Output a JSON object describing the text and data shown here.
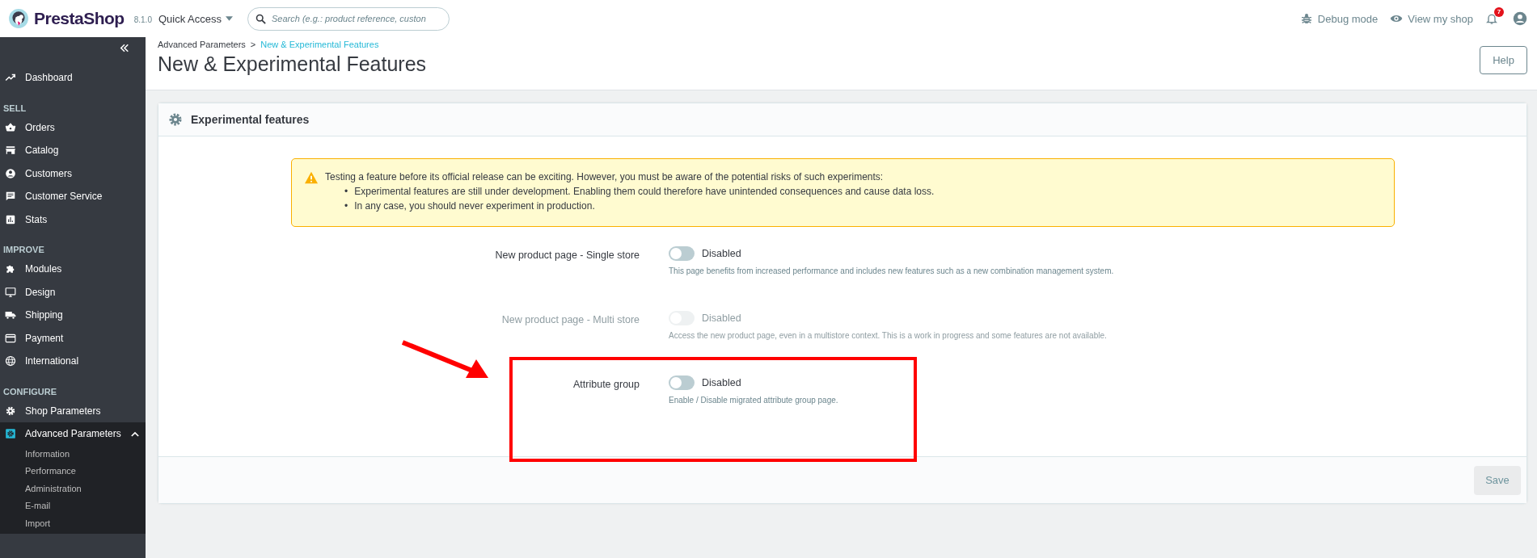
{
  "header": {
    "brand": "PrestaShop",
    "version": "8.1.0",
    "quick_access": "Quick Access",
    "search": {
      "placeholder": "Search (e.g.: product reference, custon"
    },
    "debug_mode": "Debug mode",
    "view_shop": "View my shop",
    "notifications_badge": "7"
  },
  "sidebar": {
    "top": [
      {
        "label": "Dashboard",
        "selected": false
      }
    ],
    "sections": [
      {
        "title": "SELL",
        "items": [
          {
            "label": "Orders",
            "selected": false
          },
          {
            "label": "Catalog",
            "selected": false
          },
          {
            "label": "Customers",
            "selected": false
          },
          {
            "label": "Customer Service",
            "selected": false
          },
          {
            "label": "Stats",
            "selected": false
          }
        ]
      },
      {
        "title": "IMPROVE",
        "items": [
          {
            "label": "Modules",
            "selected": false
          },
          {
            "label": "Design",
            "selected": false
          },
          {
            "label": "Shipping",
            "selected": false
          },
          {
            "label": "Payment",
            "selected": false
          },
          {
            "label": "International",
            "selected": false
          }
        ]
      },
      {
        "title": "CONFIGURE",
        "items": [
          {
            "label": "Shop Parameters",
            "selected": false
          },
          {
            "label": "Advanced Parameters",
            "selected": true,
            "expanded": true,
            "children": [
              {
                "label": "Information"
              },
              {
                "label": "Performance"
              },
              {
                "label": "Administration"
              },
              {
                "label": "E-mail"
              },
              {
                "label": "Import"
              }
            ]
          }
        ]
      }
    ]
  },
  "breadcrumb": {
    "items": [
      {
        "label": "Advanced Parameters",
        "current": false
      },
      {
        "label": "New & Experimental Features",
        "current": true
      }
    ],
    "separator": ">"
  },
  "page_title": "New & Experimental Features",
  "help_button": "Help",
  "card": {
    "title": "Experimental features",
    "alert": {
      "bullet_mark": "•",
      "intro": "Testing a feature before its official release can be exciting. However, you must be aware of the potential risks of such experiments:",
      "bullets": [
        "Experimental features are still under development. Enabling them could therefore have unintended consequences and cause data loss.",
        "In any case, you should never experiment in production."
      ]
    },
    "features": [
      {
        "label": "New product page - Single store",
        "on": false,
        "disabled": false,
        "status": "Disabled",
        "help": "This page benefits from increased performance and includes new features such as a new combination management system."
      },
      {
        "label": "New product page - Multi store",
        "on": false,
        "disabled": true,
        "status": "Disabled",
        "help": "Access the new product page, even in a multistore context. This is a work in progress and some features are not available."
      },
      {
        "label": "Attribute group",
        "on": false,
        "disabled": false,
        "status": "Disabled",
        "help": "Enable / Disable migrated attribute group page."
      }
    ],
    "save": {
      "label": "Save",
      "disabled": true
    }
  }
}
